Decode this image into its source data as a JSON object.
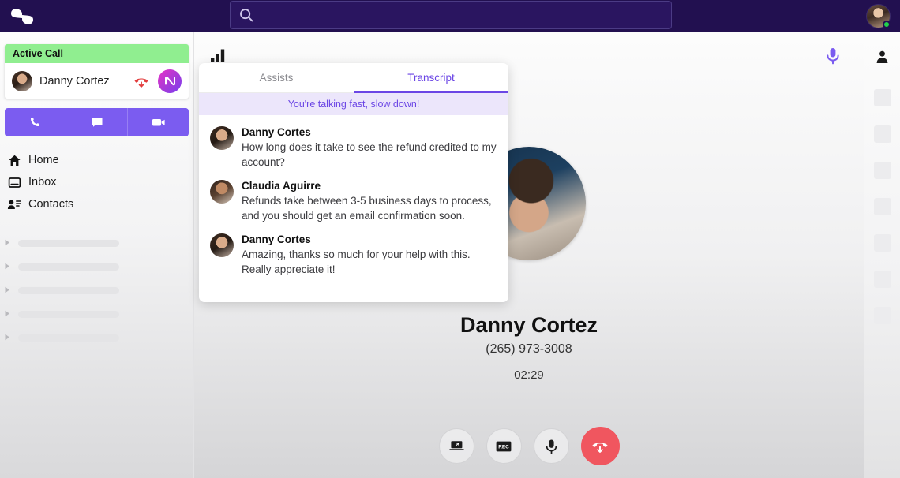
{
  "topbar": {
    "logo_icon": "chat-bubbles-logo",
    "search": {
      "value": "",
      "placeholder": "",
      "icon": "search-icon"
    },
    "avatar": {
      "name": "avatar",
      "status": "online",
      "status_color": "#21d04b"
    }
  },
  "sidebar": {
    "active_call": {
      "banner_label": "Active Call",
      "contact_name": "Danny Cortez",
      "hangup_icon": "hangup-icon",
      "badge_icon": "wave-badge-icon",
      "banner_color": "#90ee90"
    },
    "action_buttons": [
      {
        "name": "call-button",
        "icon": "phone-icon"
      },
      {
        "name": "message-button",
        "icon": "chat-icon"
      },
      {
        "name": "video-button",
        "icon": "video-icon"
      }
    ],
    "nav_items": [
      {
        "label": "Home",
        "icon": "home-icon"
      },
      {
        "label": "Inbox",
        "icon": "inbox-icon"
      },
      {
        "label": "Contacts",
        "icon": "contacts-icon"
      }
    ],
    "placeholder_rows": 5,
    "accent_color": "#7b5cf0"
  },
  "main": {
    "signal_icon": "signal-bars-icon",
    "mic_icon": "microphone-icon",
    "caller": {
      "name": "Danny Cortez",
      "phone": "(265) 973-3008",
      "timer": "02:29",
      "avatar": "caller-photo"
    },
    "controls": [
      {
        "name": "screen-share-button",
        "icon": "laptop-screen-icon",
        "label": ""
      },
      {
        "name": "record-button",
        "icon": "rec-icon",
        "label": "REC"
      },
      {
        "name": "mute-button",
        "icon": "microphone-icon",
        "label": ""
      },
      {
        "name": "end-call-button",
        "icon": "hangup-icon",
        "label": ""
      }
    ],
    "end_call_color": "#f0565f"
  },
  "panel": {
    "tabs": [
      {
        "label": "Assists",
        "active": false
      },
      {
        "label": "Transcript",
        "active": true
      }
    ],
    "alert": "You're talking fast, slow down!",
    "alert_color": "#6b46e5",
    "messages": [
      {
        "speaker": "Danny Cortes",
        "avatar": "danny",
        "text": "How long does it take to see the refund credited to my account?"
      },
      {
        "speaker": "Claudia Aguirre",
        "avatar": "claudia",
        "text": "Refunds take between 3-5 business days to process, and you should get an email confirmation soon."
      },
      {
        "speaker": "Danny Cortes",
        "avatar": "danny",
        "text": "Amazing, thanks so much for your help with this. Really appreciate it!"
      }
    ]
  },
  "rail": {
    "person_icon": "person-icon",
    "placeholder_count": 7
  }
}
